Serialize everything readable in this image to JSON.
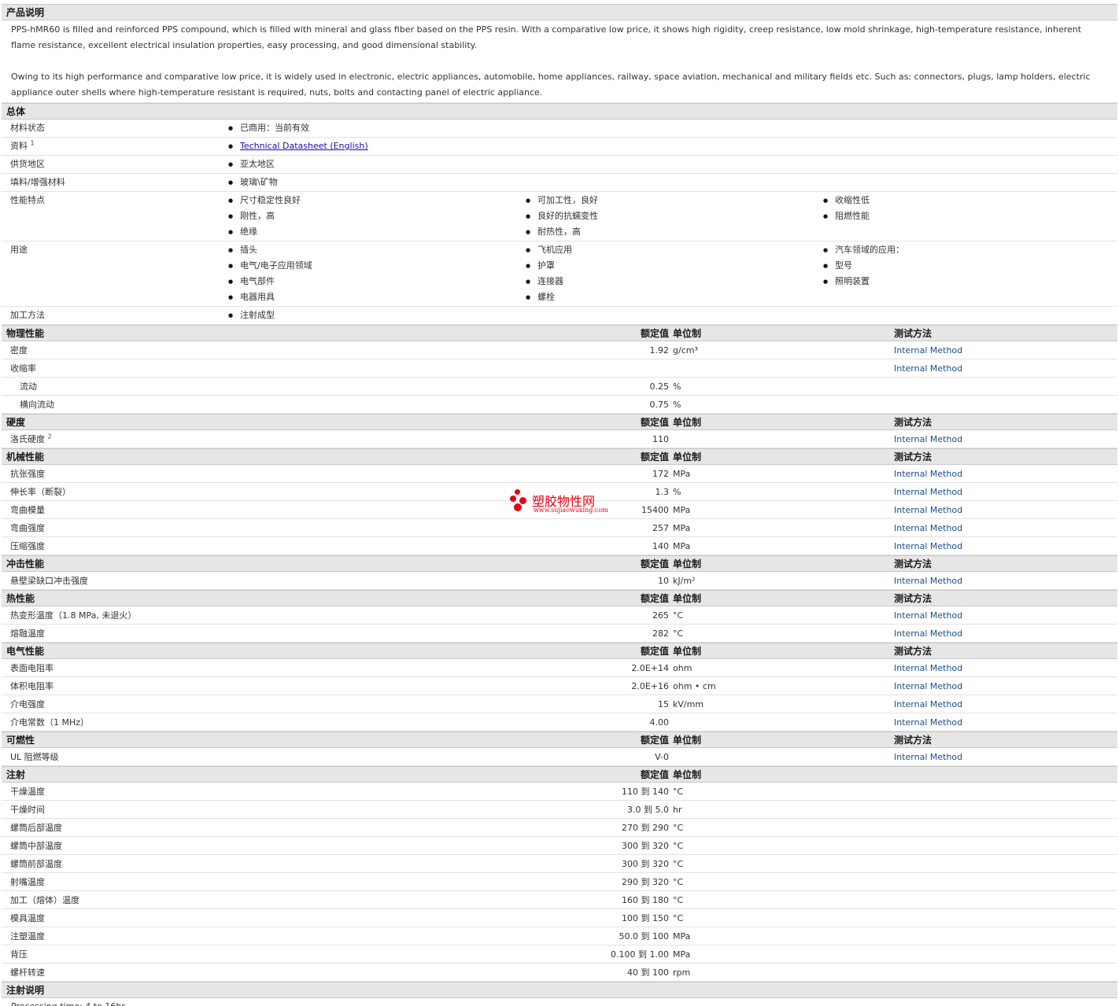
{
  "description": {
    "header": "产品说明",
    "para1": "PPS-hMR60 is filled and reinforced PPS compound, which is filled with mineral and glass fiber based on the PPS resin. With a comparative low price, it shows high rigidity, creep resistance, low mold shrinkage, high-temperature resistance, inherent flame resistance, excellent electrical insulation properties, easy processing, and good dimensional stability.",
    "para2": "Owing to its high performance and comparative low price, it is widely used in electronic, electric appliances, automobile, home appliances, railway, space aviation, mechanical and military fields etc. Such as: connectors, plugs, lamp holders, electric appliance outer shells where high-temperature resistant is required, nuts, bolts and contacting panel of electric appliance."
  },
  "general": {
    "header": "总体",
    "status_label": "材料状态",
    "status_value": "已商用：当前有效",
    "docs_label": "资料",
    "docs_sup": "1",
    "docs_link": "Technical Datasheet (English)",
    "region_label": "供货地区",
    "region_value": "亚太地区",
    "filler_label": "填料/增强材料",
    "filler_value": "玻璃\\矿物",
    "features_label": "性能特点",
    "features_col1": [
      "尺寸稳定性良好",
      "刚性，高",
      "绝缘"
    ],
    "features_col2": [
      "可加工性，良好",
      "良好的抗蠕变性",
      "耐热性，高"
    ],
    "features_col3": [
      "收缩性低",
      "阻燃性能"
    ],
    "uses_label": "用途",
    "uses_col1": [
      "插头",
      "电气/电子应用领域",
      "电气部件",
      "电器用具"
    ],
    "uses_col2": [
      "飞机应用",
      "护罩",
      "连接器",
      "螺栓"
    ],
    "uses_col3": [
      "汽车领域的应用：",
      "型号",
      "照明装置"
    ],
    "process_label": "加工方法",
    "process_value": "注射成型"
  },
  "col_headers": {
    "value": "额定值",
    "unit": "单位制",
    "test": "测试方法"
  },
  "physical": {
    "header": "物理性能",
    "rows": [
      {
        "label": "密度",
        "value": "1.92",
        "unit": "g/cm³",
        "test": "Internal Method"
      },
      {
        "label": "收缩率",
        "value": "",
        "unit": "",
        "test": "Internal Method"
      },
      {
        "label": "流动",
        "value": "0.25",
        "unit": "%",
        "test": ""
      },
      {
        "label": "横向流动",
        "value": "0.75",
        "unit": "%",
        "test": ""
      }
    ]
  },
  "hardness": {
    "header": "硬度",
    "rows": [
      {
        "label": "洛氏硬度",
        "sup": "2",
        "value": "110",
        "unit": "",
        "test": "Internal Method"
      }
    ]
  },
  "mechanical": {
    "header": "机械性能",
    "rows": [
      {
        "label": "抗张强度",
        "value": "172",
        "unit": "MPa",
        "test": "Internal Method"
      },
      {
        "label": "伸长率（断裂）",
        "value": "1.3",
        "unit": "%",
        "test": "Internal Method"
      },
      {
        "label": "弯曲模量",
        "value": "15400",
        "unit": "MPa",
        "test": "Internal Method"
      },
      {
        "label": "弯曲强度",
        "value": "257",
        "unit": "MPa",
        "test": "Internal Method"
      },
      {
        "label": "压缩强度",
        "value": "140",
        "unit": "MPa",
        "test": "Internal Method"
      }
    ]
  },
  "impact": {
    "header": "冲击性能",
    "rows": [
      {
        "label": "悬壁梁缺口冲击强度",
        "value": "10",
        "unit": "kJ/m²",
        "test": "Internal Method"
      }
    ]
  },
  "thermal": {
    "header": "热性能",
    "rows": [
      {
        "label": "热变形温度（1.8 MPa, 未退火）",
        "value": "265",
        "unit": "°C",
        "test": "Internal Method"
      },
      {
        "label": "熔融温度",
        "value": "282",
        "unit": "°C",
        "test": "Internal Method"
      }
    ]
  },
  "electrical": {
    "header": "电气性能",
    "rows": [
      {
        "label": "表面电阻率",
        "value": "2.0E+14",
        "unit": "ohm",
        "test": "Internal Method"
      },
      {
        "label": "体积电阻率",
        "value": "2.0E+16",
        "unit": "ohm • cm",
        "test": "Internal Method"
      },
      {
        "label": "介电强度",
        "value": "15",
        "unit": "kV/mm",
        "test": "Internal Method"
      },
      {
        "label": "介电常数（1 MHz）",
        "value": "4.00",
        "unit": "",
        "test": "Internal Method"
      }
    ]
  },
  "flammability": {
    "header": "可燃性",
    "rows": [
      {
        "label": "UL 阻燃等级",
        "value": "V-0",
        "unit": "",
        "test": "Internal Method"
      }
    ]
  },
  "injection": {
    "header": "注射",
    "to": "到",
    "rows": [
      {
        "label": "干燥温度",
        "from": "110",
        "upto": "140",
        "unit": "°C"
      },
      {
        "label": "干燥时间",
        "from": "3.0",
        "upto": "5.0",
        "unit": "hr"
      },
      {
        "label": "螺筒后部温度",
        "from": "270",
        "upto": "290",
        "unit": "°C"
      },
      {
        "label": "螺筒中部温度",
        "from": "300",
        "upto": "320",
        "unit": "°C"
      },
      {
        "label": "螺筒前部温度",
        "from": "300",
        "upto": "320",
        "unit": "°C"
      },
      {
        "label": "射嘴温度",
        "from": "290",
        "upto": "320",
        "unit": "°C"
      },
      {
        "label": "加工（熔体）温度",
        "from": "160",
        "upto": "180",
        "unit": "°C"
      },
      {
        "label": "模具温度",
        "from": "100",
        "upto": "150",
        "unit": "°C"
      },
      {
        "label": "注塑温度",
        "from": "50.0",
        "upto": "100",
        "unit": "MPa"
      },
      {
        "label": "背压",
        "from": "0.100",
        "upto": "1.00",
        "unit": "MPa"
      },
      {
        "label": "螺杆转速",
        "from": "40",
        "upto": "100",
        "unit": "rpm"
      }
    ]
  },
  "injection_note": {
    "header": "注射说明",
    "text": "Processing time: 4 to 16hr"
  },
  "watermark": {
    "name": "塑胶物性网",
    "url": "www.sujiaowuxing.com",
    "color": "#e60012"
  }
}
